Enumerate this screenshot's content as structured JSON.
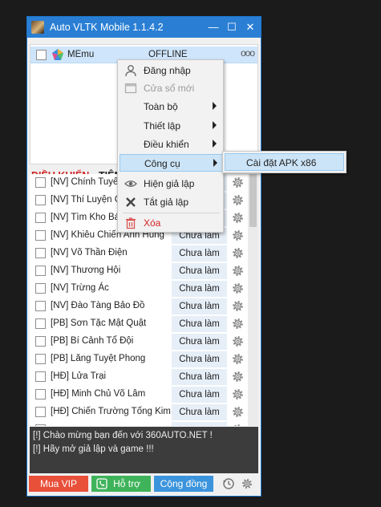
{
  "window": {
    "title": "Auto VLTK Mobile 1.1.4.2",
    "minimize_glyph": "—",
    "maximize_glyph": "☐",
    "close_glyph": "✕"
  },
  "emulator": {
    "name": "MEmu",
    "status": "OFFLINE",
    "more_glyph": "ooo"
  },
  "tabs": [
    "ĐIỀU KHIỂN",
    "TIỆN ÍCH"
  ],
  "tasks": [
    {
      "name": "[NV] Chính Tuyến",
      "status": ""
    },
    {
      "name": "[NV] Thí Luyện Giả",
      "status": ""
    },
    {
      "name": "[NV] Tìm Kho Báu",
      "status": ""
    },
    {
      "name": "[NV] Khiêu Chiến Anh Hùng",
      "status": "Chưa làm"
    },
    {
      "name": "[NV] Võ Thần Điện",
      "status": "Chưa làm"
    },
    {
      "name": "[NV] Thương Hội",
      "status": "Chưa làm"
    },
    {
      "name": "[NV] Trừng Ác",
      "status": "Chưa làm"
    },
    {
      "name": "[NV] Đào Tàng Bảo Đồ",
      "status": "Chưa làm"
    },
    {
      "name": "[PB] Sơn Tặc Mật Quật",
      "status": "Chưa làm"
    },
    {
      "name": "[PB] Bí Cảnh Tổ Đội",
      "status": "Chưa làm"
    },
    {
      "name": "[PB] Lăng Tuyệt Phong",
      "status": "Chưa làm"
    },
    {
      "name": "[HĐ] Lửa Trại",
      "status": "Chưa làm"
    },
    {
      "name": "[HĐ] Minh Chủ Võ Lâm",
      "status": "Chưa làm"
    },
    {
      "name": "[HĐ] Chiến Trường Tống Kim",
      "status": "Chưa làm"
    },
    {
      "name": "",
      "status": ""
    }
  ],
  "log": [
    "[!] Chào mừng bạn đến với 360AUTO.NET !",
    "[!] Hãy mở giả lập và game !!!"
  ],
  "buttons": {
    "vip": "Mua VIP",
    "support": "Hỗ trợ",
    "community": "Cộng đồng"
  },
  "context_menu": {
    "items": [
      {
        "label": "Đăng nhập",
        "icon": "user-icon"
      },
      {
        "label": "Cửa sổ mới",
        "icon": "window-icon",
        "disabled": true
      },
      {
        "label": "Toàn bộ",
        "submenu": true
      },
      {
        "label": "Thiết lập",
        "submenu": true
      },
      {
        "label": "Điều khiển",
        "submenu": true
      },
      {
        "label": "Công cụ",
        "submenu": true,
        "highlighted": true
      },
      {
        "label": "Hiện giả lập",
        "icon": "eye-icon"
      },
      {
        "label": "Tắt giả lập",
        "icon": "close-icon"
      },
      {
        "label": "Xóa",
        "icon": "trash-icon",
        "color": "#d12323"
      }
    ],
    "submenu": {
      "label": "Cài đặt APK x86"
    }
  },
  "colors": {
    "titlebar": "#2a7fd4",
    "vip": "#e8503a",
    "support": "#3fb35a",
    "community": "#3b94dc",
    "accent_red": "#d12323"
  }
}
